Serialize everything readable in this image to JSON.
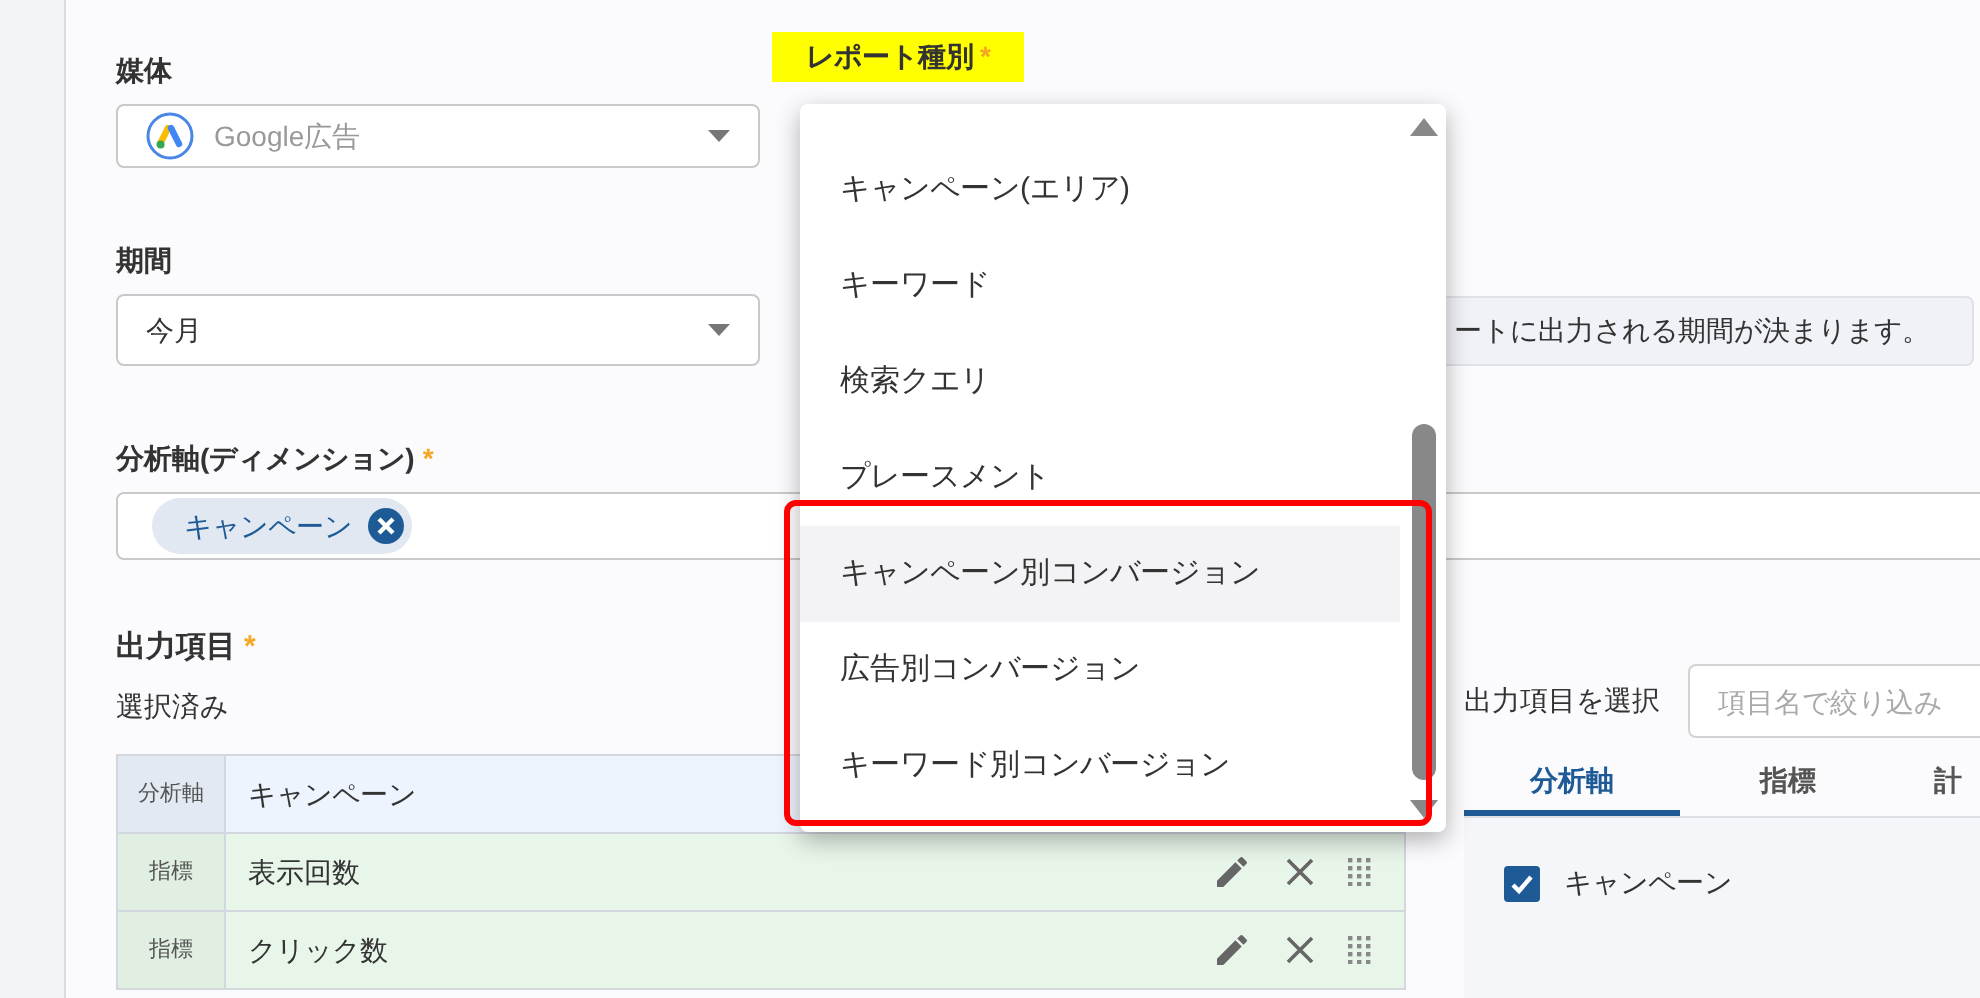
{
  "media": {
    "label": "媒体",
    "value": "Google広告"
  },
  "report_type": {
    "label": "レポート種別",
    "required_mark": "*",
    "options": [
      {
        "label": "キャンペーン(エリア)",
        "selected": false
      },
      {
        "label": "キーワード",
        "selected": false
      },
      {
        "label": "検索クエリ",
        "selected": false
      },
      {
        "label": "プレースメント",
        "selected": false
      },
      {
        "label": "キャンペーン別コンバージョン",
        "selected": true
      },
      {
        "label": "広告別コンバージョン",
        "selected": false
      },
      {
        "label": "キーワード別コンバージョン",
        "selected": false
      }
    ]
  },
  "period": {
    "label": "期間",
    "value": "今月",
    "hint": "ートに出力される期間が決まります。"
  },
  "dimension": {
    "label": "分析軸(ディメンション)",
    "required_mark": "*",
    "chips": [
      "キャンペーン"
    ]
  },
  "output": {
    "label": "出力項目",
    "required_mark": "*",
    "selected_label": "選択済み",
    "rows": [
      {
        "kind": "dimension",
        "tag": "分析軸",
        "name": "キャンペーン"
      },
      {
        "kind": "metric",
        "tag": "指標",
        "name": "表示回数"
      },
      {
        "kind": "metric",
        "tag": "指標",
        "name": "クリック数"
      }
    ]
  },
  "picker": {
    "label": "出力項目を選択",
    "search_placeholder": "項目名で絞り込み",
    "tabs": [
      {
        "label": "分析軸",
        "selected": true
      },
      {
        "label": "指標",
        "selected": false
      },
      {
        "label": "計",
        "selected": false
      }
    ],
    "items": [
      {
        "label": "キャンペーン",
        "checked": true
      }
    ]
  }
}
